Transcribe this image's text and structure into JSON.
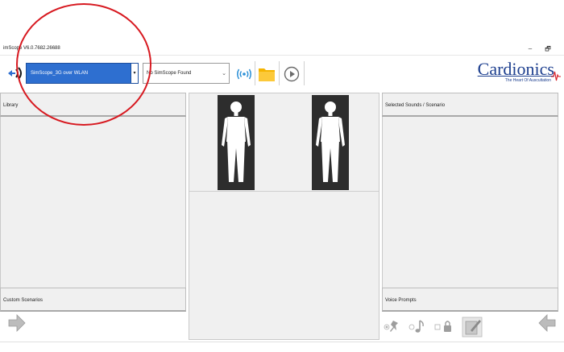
{
  "window": {
    "title": "imScope V6.0.7682.26688",
    "minimize_glyph": "–",
    "restore_glyph": "🗗"
  },
  "toolbar": {
    "connection_select": {
      "value": "SimScope_3G over WLAN",
      "arrow": "▾"
    },
    "device_select": {
      "value": "No SimScope Found",
      "arrow": "⌄"
    },
    "icons": [
      "back-connect-icon",
      "wireless-icon",
      "folder-icon",
      "play-icon"
    ]
  },
  "logo": {
    "name": "Cardionics",
    "tagline": "The Heart Of Auscultation"
  },
  "left_panel": {
    "library_label": "Library",
    "custom_scenarios_label": "Custom Scenarios"
  },
  "right_panel": {
    "selected_label": "Selected Sounds / Scenario",
    "voice_prompts_label": "Voice Prompts"
  },
  "colors": {
    "accent_blue": "#2e6fd0",
    "logo_blue": "#1d3f8f",
    "annotation_red": "#d71920",
    "body_card": "#2d2d2d",
    "panel_bg": "#f0f0f0"
  }
}
